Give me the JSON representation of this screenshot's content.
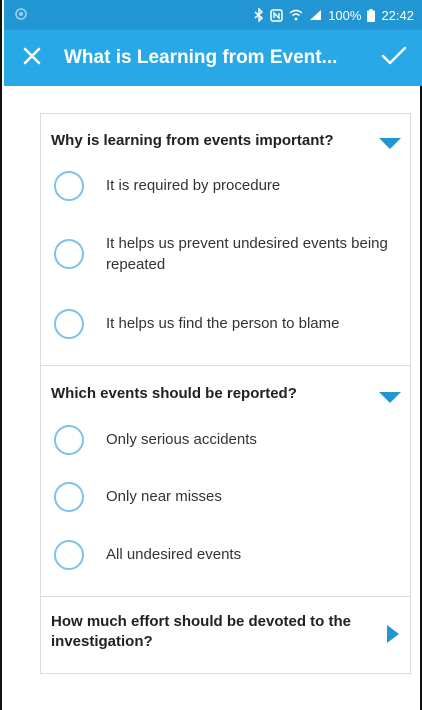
{
  "status_bar": {
    "battery": "100%",
    "time": "22:42",
    "icons": [
      "bluetooth-icon",
      "nfc-icon",
      "wifi-icon",
      "signal-icon",
      "battery-icon"
    ]
  },
  "app_bar": {
    "title": "What is Learning from Event...",
    "close_icon": "close-icon",
    "confirm_icon": "check-icon"
  },
  "colors": {
    "status_bar": "#2196d3",
    "app_bar": "#29a8e8",
    "accent": "#2196d3",
    "radio_border": "#7ec0ee"
  },
  "sections": [
    {
      "question": "Why is learning from events important?",
      "expanded": true,
      "options": [
        "It is required by procedure",
        "It helps us prevent undesired events being repeated",
        "It helps us find the person to blame"
      ]
    },
    {
      "question": "Which events should be reported?",
      "expanded": true,
      "options": [
        "Only serious accidents",
        "Only near misses",
        "All undesired events"
      ]
    },
    {
      "question": "How much effort should be devoted to the investigation?",
      "expanded": false,
      "options": []
    }
  ]
}
